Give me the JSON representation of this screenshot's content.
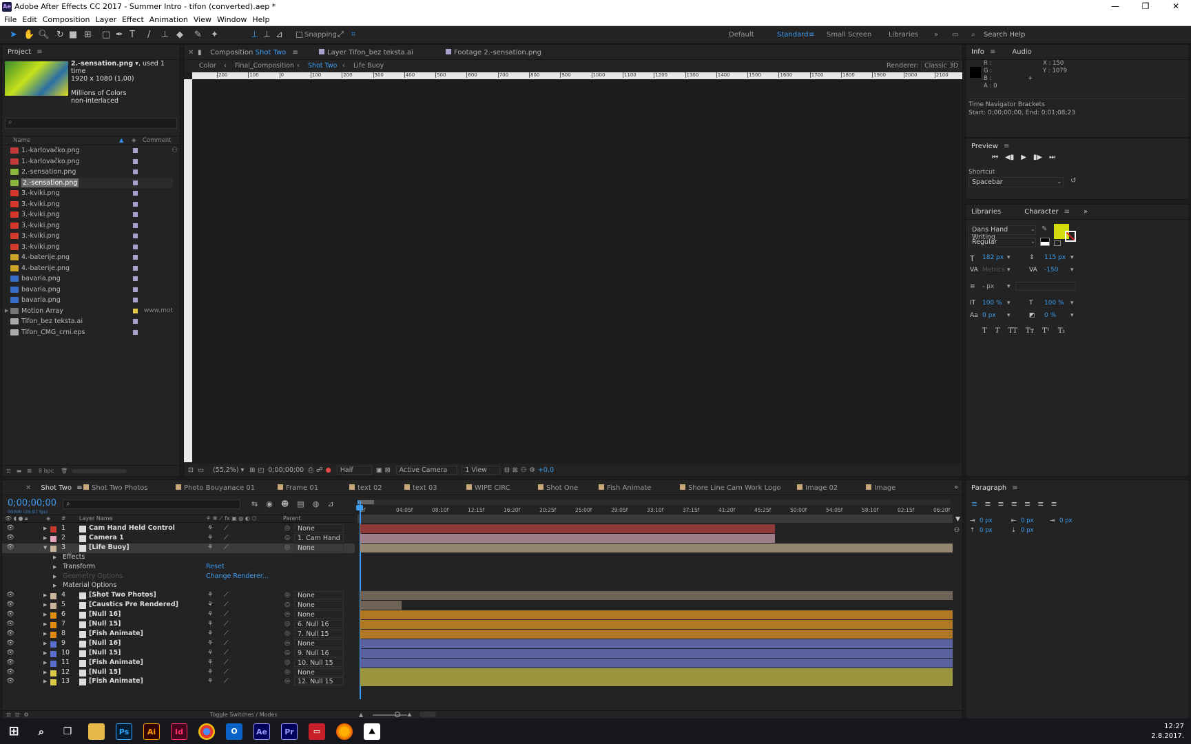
{
  "window": {
    "title": "Adobe After Effects CC 2017 - Summer Intro - tifon (converted).aep *",
    "app_icon": "Ae",
    "minimize": "—",
    "maximize": "❐",
    "close": "✕"
  },
  "menu": [
    "File",
    "Edit",
    "Composition",
    "Layer",
    "Effect",
    "Animation",
    "View",
    "Window",
    "Help"
  ],
  "toolbar": {
    "snapping_label": "Snapping",
    "workspaces": [
      "Default",
      "Standard",
      "Small Screen",
      "Libraries"
    ],
    "active_workspace": "Standard",
    "search_placeholder": "Search Help"
  },
  "project": {
    "title": "Project",
    "selected_name": "2.-sensation.png",
    "used": ", used 1 time",
    "dimensions": "1920 x 1080 (1,00)",
    "colors": "Millions of Colors",
    "interlace": "non-interlaced",
    "search_placeholder": "",
    "col_name": "Name",
    "col_comment": "Comment",
    "items": [
      {
        "name": "1.-karlovačko.png",
        "icon_color": "#c23b3b",
        "comment": ""
      },
      {
        "name": "1.-karlovačko.png",
        "icon_color": "#c23b3b",
        "comment": ""
      },
      {
        "name": "2.-sensation.png",
        "icon_color": "#8ab63c",
        "comment": ""
      },
      {
        "name": "2.-sensation.png",
        "icon_color": "#8ab63c",
        "comment": "",
        "selected": true
      },
      {
        "name": "3.-kviki.png",
        "icon_color": "#d33a2c",
        "comment": ""
      },
      {
        "name": "3.-kviki.png",
        "icon_color": "#d33a2c",
        "comment": ""
      },
      {
        "name": "3.-kviki.png",
        "icon_color": "#d33a2c",
        "comment": ""
      },
      {
        "name": "3.-kviki.png",
        "icon_color": "#d33a2c",
        "comment": ""
      },
      {
        "name": "3.-kviki.png",
        "icon_color": "#d33a2c",
        "comment": ""
      },
      {
        "name": "3.-kviki.png",
        "icon_color": "#d33a2c",
        "comment": ""
      },
      {
        "name": "4.-baterije.png",
        "icon_color": "#c9a227",
        "comment": ""
      },
      {
        "name": "4.-baterije.png",
        "icon_color": "#c9a227",
        "comment": ""
      },
      {
        "name": "bavaria.png",
        "icon_color": "#3a6fc9",
        "comment": ""
      },
      {
        "name": "bavaria.png",
        "icon_color": "#3a6fc9",
        "comment": ""
      },
      {
        "name": "bavaria.png",
        "icon_color": "#3a6fc9",
        "comment": ""
      },
      {
        "name": "Motion Array",
        "icon_color": "#777777",
        "comment": "www.mot",
        "folder": true
      },
      {
        "name": "Tifon_bez teksta.ai",
        "icon_color": "#aaaaaa",
        "comment": ""
      },
      {
        "name": "Tifon_CMG_crni.eps",
        "icon_color": "#aaaaaa",
        "comment": ""
      }
    ],
    "bpc": "8 bpc"
  },
  "viewer": {
    "tabs": [
      {
        "label": "Composition",
        "name": "Shot Two"
      },
      {
        "label": "Layer",
        "name": "Tifon_bez teksta.ai"
      },
      {
        "label": "Footage",
        "name": "2.-sensation.png"
      }
    ],
    "breadcrumbs": [
      "Color",
      "Final_Composition",
      "Shot Two",
      "Life Buoy"
    ],
    "renderer_label": "Renderer:",
    "renderer": "Classic 3D",
    "ruler": [
      "200",
      "100",
      "0",
      "100",
      "200",
      "300",
      "400",
      "500",
      "600",
      "700",
      "800",
      "900",
      "1000",
      "1100",
      "1200",
      "1300",
      "1400",
      "1500",
      "1600",
      "1700",
      "1800",
      "1900",
      "2000",
      "2100"
    ],
    "zoom": "(55,2%)",
    "timecode": "0;00;00;00",
    "resolution": "Half",
    "camera": "Active Camera",
    "views": "1 View",
    "exposure": "+0,0"
  },
  "info": {
    "tab1": "Info",
    "tab2": "Audio",
    "r": "R :",
    "g": "G :",
    "b": "B :",
    "a": "A : 0",
    "x": "X : 150",
    "y": "Y : 1079",
    "nav_title": "Time Navigator Brackets",
    "nav_range": "Start: 0;00;00;00, End: 0;01;08;23"
  },
  "preview": {
    "title": "Preview",
    "shortcut_label": "Shortcut",
    "shortcut": "Spacebar"
  },
  "character": {
    "tab1": "Libraries",
    "tab2": "Character",
    "font": "Dans Hand Writing",
    "style": "Regular",
    "size": "182 px",
    "leading": "115 px",
    "kerning": "Metrics",
    "tracking": "-150",
    "stroke": "- px",
    "vscale": "100 %",
    "hscale": "100 %",
    "baseline": "0 px",
    "tsume": "0 %",
    "fill_color": "#d4dc0c"
  },
  "paragraph": {
    "title": "Paragraph",
    "values": [
      "0 px",
      "0 px",
      "0 px",
      "0 px",
      "0 px"
    ]
  },
  "timeline": {
    "tabs": [
      "Shot Two",
      "Shot Two Photos",
      "Photo Bouyanace 01",
      "Frame 01",
      "text 02",
      "text 03",
      "WIPE CIRC",
      "Shot One",
      "Fish Animate",
      "Shore Line Cam Work Logo",
      "Image 02",
      "Image"
    ],
    "timecode": "0;00;00;00",
    "fps": "00000 (29.97 fps)",
    "col_layer": "Layer Name",
    "col_parent": "Parent",
    "ruler": [
      "0f",
      "04:05f",
      "08:10f",
      "12:15f",
      "16:20f",
      "20:25f",
      "25:00f",
      "29:05f",
      "33:10f",
      "37:15f",
      "41:20f",
      "45:25f",
      "50:00f",
      "54:05f",
      "58:10f",
      "02:15f",
      "06:20f"
    ],
    "layers": [
      {
        "num": "1",
        "name": "Cam Hand Held Control",
        "label": "#c0392b",
        "parent": "None",
        "bar": "#8f3a3a",
        "bar_end": 0.7
      },
      {
        "num": "2",
        "name": "Camera 1",
        "label": "#e3a6b8",
        "parent": "1. Cam Hand",
        "bar": "#9d7d8a",
        "bar_end": 0.7
      },
      {
        "num": "3",
        "name": "[Life Buoy]",
        "label": "#c8b49a",
        "parent": "None",
        "bar": "#948570",
        "bar_end": 1.0,
        "selected": true
      },
      {
        "num": "",
        "name": "Effects",
        "label": "",
        "parent": "",
        "bar": "",
        "bar_end": 0
      },
      {
        "num": "",
        "name": "Transform",
        "label": "",
        "parent": "",
        "extra": "Reset",
        "bar": "",
        "bar_end": 0
      },
      {
        "num": "",
        "name": "Geometry Options",
        "label": "",
        "parent": "",
        "extra": "Change Renderer...",
        "bar": "",
        "bar_end": 0
      },
      {
        "num": "",
        "name": "Material Options",
        "label": "",
        "parent": "",
        "bar": "",
        "bar_end": 0
      },
      {
        "num": "4",
        "name": "[Shot Two Photos]",
        "label": "#c8b49a",
        "parent": "None",
        "bar": "#6f6357",
        "bar_end": 1.0
      },
      {
        "num": "5",
        "name": "[Caustics Pre Rendered]",
        "label": "#c8b49a",
        "parent": "None",
        "bar": "#6f6357",
        "bar_end": 0.07
      },
      {
        "num": "6",
        "name": "[Null 16]",
        "label": "#e08a14",
        "parent": "None",
        "bar": "#b07822",
        "bar_end": 1.0
      },
      {
        "num": "7",
        "name": "[Null 15]",
        "label": "#e08a14",
        "parent": "6. Null 16",
        "bar": "#b07822",
        "bar_end": 1.0
      },
      {
        "num": "8",
        "name": "[Fish Animate]",
        "label": "#e08a14",
        "parent": "7. Null 15",
        "bar": "#b07822",
        "bar_end": 1.0
      },
      {
        "num": "9",
        "name": "[Null 16]",
        "label": "#5a6ed0",
        "parent": "None",
        "bar": "#5a62a0",
        "bar_end": 1.0
      },
      {
        "num": "10",
        "name": "[Null 15]",
        "label": "#5a6ed0",
        "parent": "9. Null 16",
        "bar": "#5a62a0",
        "bar_end": 1.0
      },
      {
        "num": "11",
        "name": "[Fish Animate]",
        "label": "#5a6ed0",
        "parent": "10. Null 15",
        "bar": "#5a62a0",
        "bar_end": 1.0
      },
      {
        "num": "12",
        "name": "[Null 15]",
        "label": "#d8c84a",
        "parent": "None",
        "bar": "#9c9540",
        "bar_end": 1.0
      },
      {
        "num": "13",
        "name": "[Fish Animate]",
        "label": "#d8c84a",
        "parent": "12. Null 15",
        "bar": "#9c9540",
        "bar_end": 1.0
      }
    ],
    "toggle_label": "Toggle Switches / Modes"
  },
  "taskbar": {
    "clock": "12:27",
    "date": "2.8.2017.",
    "apps": [
      {
        "name": "Ps",
        "color": "#31a8ff",
        "bg": "#001e36"
      },
      {
        "name": "Ai",
        "color": "#ff9a00",
        "bg": "#330000"
      },
      {
        "name": "Id",
        "color": "#ff3366",
        "bg": "#49021f"
      },
      {
        "name": "Ae",
        "color": "#9999ff",
        "bg": "#00005b"
      },
      {
        "name": "Pr",
        "color": "#9999ff",
        "bg": "#00005b"
      }
    ]
  }
}
